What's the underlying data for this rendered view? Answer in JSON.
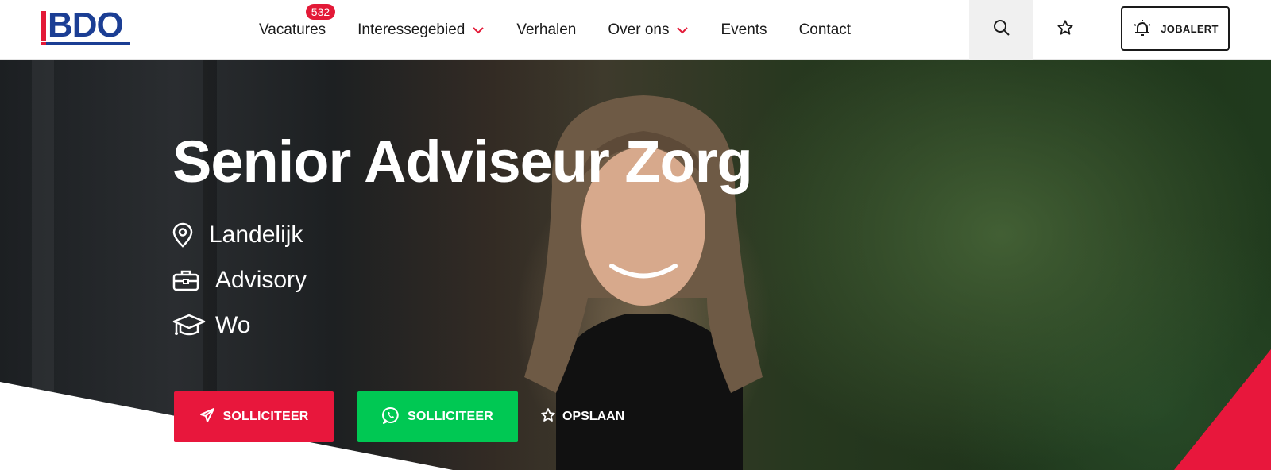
{
  "header": {
    "logo_text": "BDO",
    "nav": [
      {
        "label": "Vacatures",
        "badge": "532",
        "has_dropdown": false
      },
      {
        "label": "Interessegebied",
        "has_dropdown": true
      },
      {
        "label": "Verhalen",
        "has_dropdown": false
      },
      {
        "label": "Over ons",
        "has_dropdown": true
      },
      {
        "label": "Events",
        "has_dropdown": false
      },
      {
        "label": "Contact",
        "has_dropdown": false
      }
    ],
    "search_icon": "search-icon",
    "favorites_icon": "star-icon",
    "jobalert_label": "JOBALERT"
  },
  "hero": {
    "title": "Senior Adviseur Zorg",
    "location": "Landelijk",
    "department": "Advisory",
    "education": "Wo",
    "apply_label": "SOLLICITEER",
    "whatsapp_label": "SOLLICITEER",
    "save_label": "OPSLAAN"
  },
  "colors": {
    "brand_blue": "#1b3e94",
    "brand_red": "#e31937",
    "apply_red": "#e8173c",
    "whatsapp_green": "#00c853"
  }
}
